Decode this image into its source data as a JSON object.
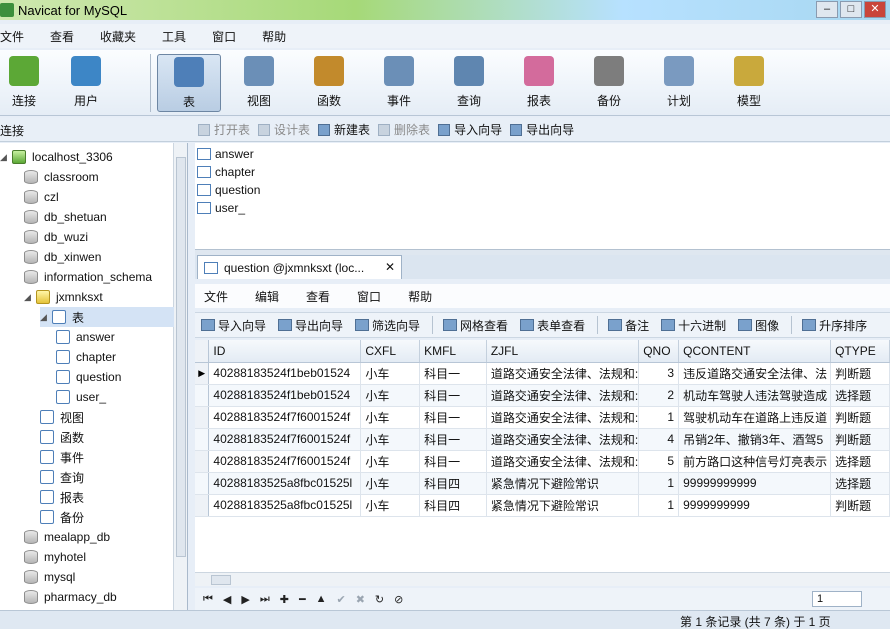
{
  "window": {
    "title": "Navicat for MySQL"
  },
  "menubar": [
    "文件",
    "查看",
    "收藏夹",
    "工具",
    "窗口",
    "帮助"
  ],
  "toolbar": [
    {
      "label": "连接",
      "icon": "connection-icon"
    },
    {
      "label": "用户",
      "icon": "user-icon"
    },
    {
      "label": "表",
      "icon": "table-icon"
    },
    {
      "label": "视图",
      "icon": "view-icon"
    },
    {
      "label": "函数",
      "icon": "function-icon"
    },
    {
      "label": "事件",
      "icon": "event-icon"
    },
    {
      "label": "查询",
      "icon": "query-icon"
    },
    {
      "label": "报表",
      "icon": "report-icon"
    },
    {
      "label": "备份",
      "icon": "backup-icon"
    },
    {
      "label": "计划",
      "icon": "schedule-icon"
    },
    {
      "label": "模型",
      "icon": "model-icon"
    }
  ],
  "connection_label": "连接",
  "object_tools": [
    {
      "label": "打开表",
      "enabled": false
    },
    {
      "label": "设计表",
      "enabled": false
    },
    {
      "label": "新建表",
      "enabled": true
    },
    {
      "label": "删除表",
      "enabled": false
    },
    {
      "label": "导入向导",
      "enabled": true
    },
    {
      "label": "导出向导",
      "enabled": true
    }
  ],
  "tree": [
    {
      "label": "localhost_3306",
      "kind": "conn",
      "level": 0,
      "expanded": true
    },
    {
      "label": "classroom",
      "kind": "db",
      "level": 1
    },
    {
      "label": "czl",
      "kind": "db",
      "level": 1
    },
    {
      "label": "db_shetuan",
      "kind": "db",
      "level": 1
    },
    {
      "label": "db_wuzi",
      "kind": "db",
      "level": 1
    },
    {
      "label": "db_xinwen",
      "kind": "db",
      "level": 1
    },
    {
      "label": "information_schema",
      "kind": "db",
      "level": 1
    },
    {
      "label": "jxmnksxt",
      "kind": "dbopen",
      "level": 1,
      "expanded": true
    },
    {
      "label": "表",
      "kind": "tbl",
      "level": 2,
      "expanded": true,
      "selected": true
    },
    {
      "label": "answer",
      "kind": "tbl",
      "level": 3
    },
    {
      "label": "chapter",
      "kind": "tbl",
      "level": 3
    },
    {
      "label": "question",
      "kind": "tbl",
      "level": 3
    },
    {
      "label": "user_",
      "kind": "tbl",
      "level": 3
    },
    {
      "label": "视图",
      "kind": "view",
      "level": 2
    },
    {
      "label": "函数",
      "kind": "func",
      "level": 2
    },
    {
      "label": "事件",
      "kind": "event",
      "level": 2
    },
    {
      "label": "查询",
      "kind": "query",
      "level": 2
    },
    {
      "label": "报表",
      "kind": "report",
      "level": 2
    },
    {
      "label": "备份",
      "kind": "backup",
      "level": 2
    },
    {
      "label": "mealapp_db",
      "kind": "db",
      "level": 1
    },
    {
      "label": "myhotel",
      "kind": "db",
      "level": 1
    },
    {
      "label": "mysql",
      "kind": "db",
      "level": 1
    },
    {
      "label": "pharmacy_db",
      "kind": "db",
      "level": 1
    }
  ],
  "tables": [
    "answer",
    "chapter",
    "question",
    "user_"
  ],
  "doc_tab": {
    "label": "question @jxmnksxt (loc...",
    "close": "✕"
  },
  "inner_menu": [
    "文件",
    "编辑",
    "查看",
    "窗口",
    "帮助"
  ],
  "grid_tools": [
    "导入向导",
    "导出向导",
    "筛选向导",
    "网格查看",
    "表单查看",
    "备注",
    "十六进制",
    "图像",
    "升序排序"
  ],
  "grid": {
    "columns": [
      "ID",
      "CXFL",
      "KMFL",
      "ZJFL",
      "QNO",
      "QCONTENT",
      "QTYPE"
    ],
    "rows": [
      [
        "40288183524f1beb01524",
        "小车",
        "科目一",
        "道路交通安全法律、法规和:",
        "3",
        "违反道路交通安全法律、法",
        "判断题"
      ],
      [
        "40288183524f1beb01524",
        "小车",
        "科目一",
        "道路交通安全法律、法规和:",
        "2",
        "机动车驾驶人违法驾驶造成",
        "选择题"
      ],
      [
        "40288183524f7f6001524f",
        "小车",
        "科目一",
        "道路交通安全法律、法规和:",
        "1",
        "驾驶机动车在道路上违反道",
        "判断题"
      ],
      [
        "40288183524f7f6001524f",
        "小车",
        "科目一",
        "道路交通安全法律、法规和:",
        "4",
        "吊销2年、撤销3年、酒驾5",
        "判断题"
      ],
      [
        "40288183524f7f6001524f",
        "小车",
        "科目一",
        "道路交通安全法律、法规和:",
        "5",
        "前方路口这种信号灯亮表示",
        "选择题"
      ],
      [
        "40288183525a8fbc01525l",
        "小车",
        "科目四",
        "紧急情况下避险常识",
        "1",
        "99999999999",
        "选择题"
      ],
      [
        "40288183525a8fbc01525l",
        "小车",
        "科目四",
        "紧急情况下避险常识",
        "1",
        "9999999999",
        "判断题"
      ]
    ]
  },
  "nav": [
    "⏮",
    "◀",
    "▶",
    "⏭",
    "✚",
    "━",
    "▲",
    "✔",
    "✖",
    "↻",
    "⊘"
  ],
  "page_value": "1",
  "status": "第 1 条记录 (共 7 条) 于 1 页"
}
